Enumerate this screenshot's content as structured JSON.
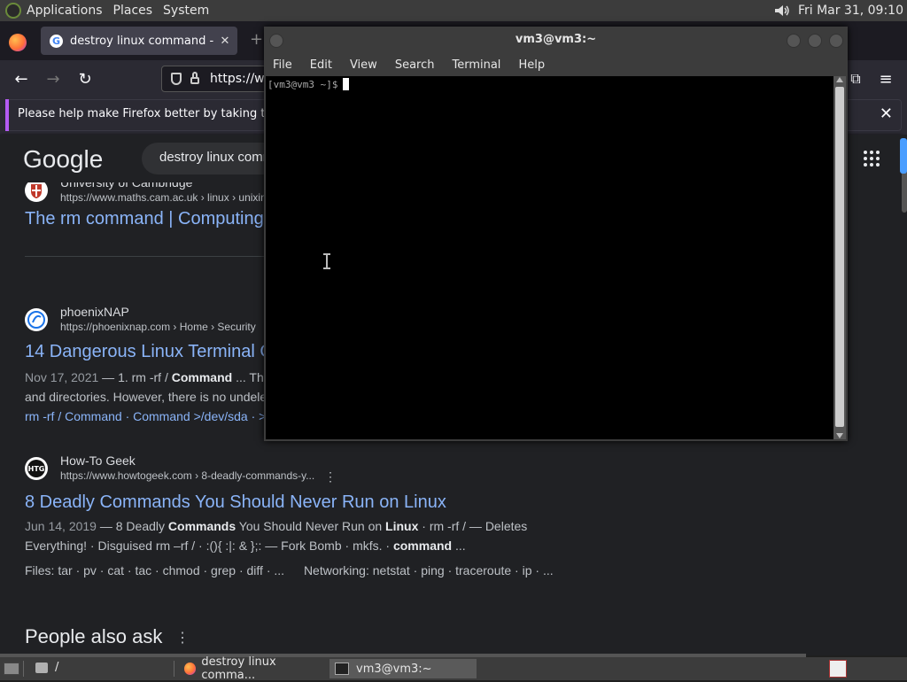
{
  "top_panel": {
    "menus": [
      "Applications",
      "Places",
      "System"
    ],
    "clock": "Fri Mar 31, 09:10"
  },
  "firefox": {
    "tab_title": "destroy linux command - Go",
    "url": "https://w",
    "notification": "Please help make Firefox better by taking this s"
  },
  "google": {
    "logo": "Google",
    "search_value": "destroy linux comm",
    "results": [
      {
        "site": "University of Cambridge",
        "url": "https://www.maths.cam.ac.uk › linux › unixin",
        "title": "The rm command | Computing"
      },
      {
        "site": "phoenixNAP",
        "url": "https://phoenixnap.com › Home › Security",
        "title": "14 Dangerous Linux Terminal C",
        "date": "Nov 17, 2021",
        "snippet_1_pre": " — 1. rm -rf / ",
        "snippet_1_bold": "Command",
        "snippet_1_post": " ... Th",
        "snippet_2": "and directories. However, there is no undele",
        "links": "rm -rf / Command · Command >/dev/sda · >"
      },
      {
        "site": "How-To Geek",
        "url": "https://www.howtogeek.com › 8-deadly-commands-y...",
        "title": "8 Deadly Commands You Should Never Run on Linux",
        "date": "Jun 14, 2019",
        "snippet_1_a": " — 8 Deadly ",
        "snippet_1_b": "Commands",
        "snippet_1_c": " You Should Never Run on ",
        "snippet_1_d": "Linux",
        "snippet_1_e": " · rm -rf / — Deletes",
        "snippet_2_a": "Everything! · Disguised rm –rf / · :(){ :|: & };: — Fork Bomb · mkfs. · ",
        "snippet_2_b": "command",
        "snippet_2_c": " ...",
        "files_label": "Files: ",
        "files_links": "tar · pv · cat · tac · chmod · grep · diff · ...",
        "net_label": "Networking: ",
        "net_links": "netstat · ping · traceroute · ip · ..."
      }
    ],
    "people_also_ask": "People also ask"
  },
  "terminal": {
    "title": "vm3@vm3:~",
    "menus": [
      "File",
      "Edit",
      "View",
      "Search",
      "Terminal",
      "Help"
    ],
    "prompt": "[vm3@vm3 ~]$"
  },
  "taskbar": {
    "path": "/",
    "firefox_item": "destroy linux comma...",
    "terminal_item": "vm3@vm3:~"
  }
}
